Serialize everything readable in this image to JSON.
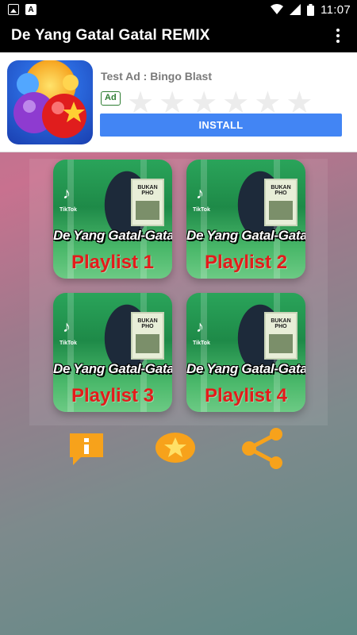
{
  "status_bar": {
    "time": "11:07"
  },
  "app_bar": {
    "title": "De Yang Gatal Gatal REMIX"
  },
  "ad": {
    "title": "Test Ad : Bingo Blast",
    "badge": "Ad",
    "install_label": "INSTALL",
    "star_count": 6
  },
  "tiles": [
    {
      "song": "De Yang Gatal-Gatal",
      "label": "Playlist 1",
      "tiktok": "TikTok",
      "poster": "BUKAN PHO"
    },
    {
      "song": "De Yang Gatal-Gatal",
      "label": "Playlist 2",
      "tiktok": "TikTok",
      "poster": "BUKAN PHO"
    },
    {
      "song": "De Yang Gatal-Gatal",
      "label": "Playlist 3",
      "tiktok": "TikTok",
      "poster": "BUKAN PHO"
    },
    {
      "song": "De Yang Gatal-Gatal",
      "label": "Playlist 4",
      "tiktok": "TikTok",
      "poster": "BUKAN PHO"
    }
  ],
  "actions": [
    {
      "icon": "info-icon"
    },
    {
      "icon": "star-icon"
    },
    {
      "icon": "share-icon"
    }
  ],
  "colors": {
    "accent_orange": "#f7a21b",
    "install_blue": "#4285f4",
    "playlist_red": "#e41b1b"
  }
}
